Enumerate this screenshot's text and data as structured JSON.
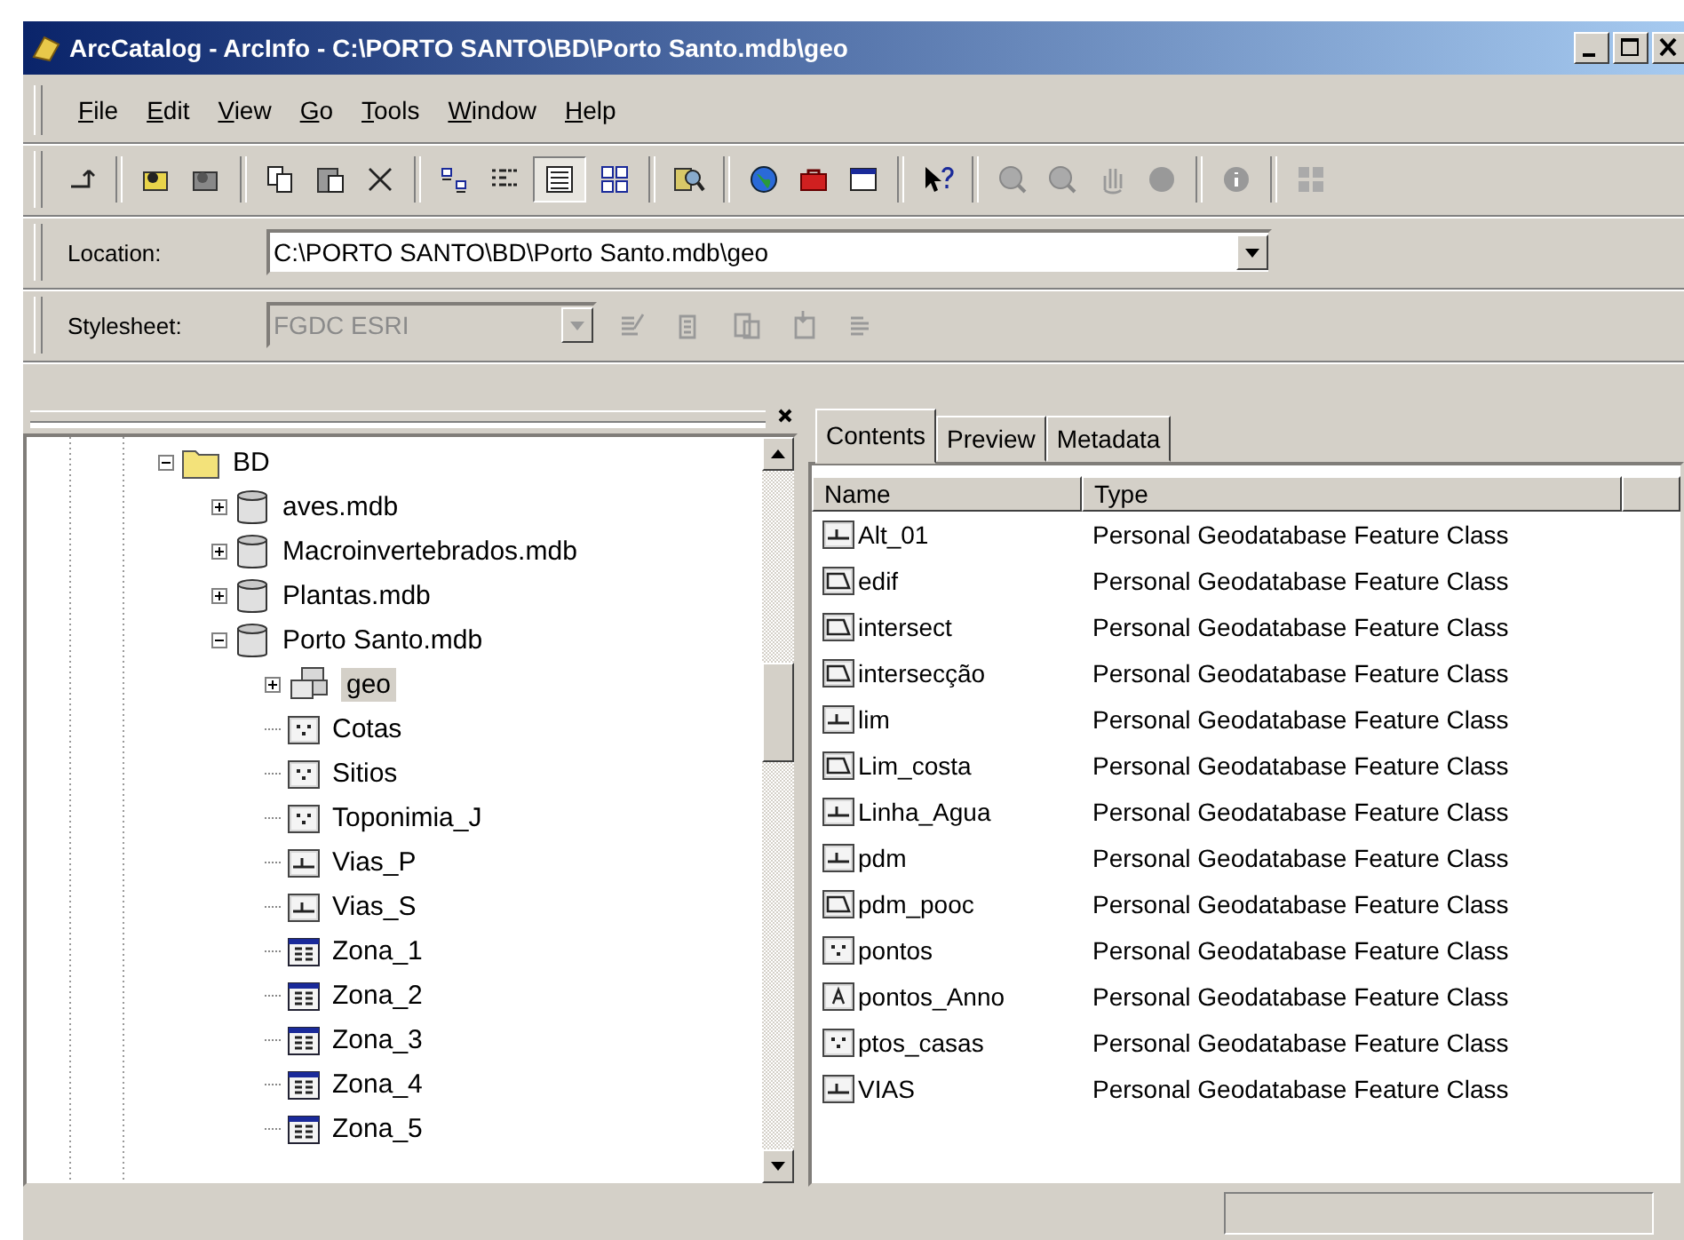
{
  "window": {
    "title": "ArcCatalog - ArcInfo - C:\\PORTO SANTO\\BD\\Porto Santo.mdb\\geo"
  },
  "menu": [
    "File",
    "Edit",
    "View",
    "Go",
    "Tools",
    "Window",
    "Help"
  ],
  "location": {
    "label": "Location:",
    "value": "C:\\PORTO SANTO\\BD\\Porto Santo.mdb\\geo"
  },
  "stylesheet": {
    "label": "Stylesheet:",
    "value": "FGDC ESRI",
    "disabled": true
  },
  "tree": [
    {
      "label": "BD",
      "kind": "folder",
      "expanded": true,
      "selected": false,
      "children": [
        {
          "label": "aves.mdb",
          "kind": "database",
          "expanded": false,
          "selected": false
        },
        {
          "label": "Macroinvertebrados.mdb",
          "kind": "database",
          "expanded": false,
          "selected": false
        },
        {
          "label": "Plantas.mdb",
          "kind": "database",
          "expanded": false,
          "selected": false
        },
        {
          "label": "Porto Santo.mdb",
          "kind": "database",
          "expanded": true,
          "selected": false,
          "children": [
            {
              "label": "geo",
              "kind": "dataset",
              "expanded": false,
              "selected": true
            },
            {
              "label": "Cotas",
              "kind": "point",
              "selected": false
            },
            {
              "label": "Sitios",
              "kind": "point",
              "selected": false
            },
            {
              "label": "Toponimia_J",
              "kind": "point",
              "selected": false
            },
            {
              "label": "Vias_P",
              "kind": "line",
              "selected": false
            },
            {
              "label": "Vias_S",
              "kind": "line",
              "selected": false
            },
            {
              "label": "Zona_1",
              "kind": "table",
              "selected": false
            },
            {
              "label": "Zona_2",
              "kind": "table",
              "selected": false
            },
            {
              "label": "Zona_3",
              "kind": "table",
              "selected": false
            },
            {
              "label": "Zona_4",
              "kind": "table",
              "selected": false
            },
            {
              "label": "Zona_5",
              "kind": "table",
              "selected": false
            }
          ]
        }
      ]
    }
  ],
  "tabs": [
    {
      "label": "Contents",
      "selected": true
    },
    {
      "label": "Preview",
      "selected": false
    },
    {
      "label": "Metadata",
      "selected": false
    }
  ],
  "contents": {
    "columns": [
      "Name",
      "Type"
    ],
    "rows": [
      {
        "name": "Alt_01",
        "kind": "line",
        "type": "Personal Geodatabase Feature Class"
      },
      {
        "name": "edif",
        "kind": "polygon",
        "type": "Personal Geodatabase Feature Class"
      },
      {
        "name": "intersect",
        "kind": "polygon",
        "type": "Personal Geodatabase Feature Class"
      },
      {
        "name": "intersecção",
        "kind": "polygon",
        "type": "Personal Geodatabase Feature Class"
      },
      {
        "name": "lim",
        "kind": "line",
        "type": "Personal Geodatabase Feature Class"
      },
      {
        "name": "Lim_costa",
        "kind": "polygon",
        "type": "Personal Geodatabase Feature Class"
      },
      {
        "name": "Linha_Agua",
        "kind": "line",
        "type": "Personal Geodatabase Feature Class"
      },
      {
        "name": "pdm",
        "kind": "line",
        "type": "Personal Geodatabase Feature Class"
      },
      {
        "name": "pdm_pooc",
        "kind": "polygon",
        "type": "Personal Geodatabase Feature Class"
      },
      {
        "name": "pontos",
        "kind": "point",
        "type": "Personal Geodatabase Feature Class"
      },
      {
        "name": "pontos_Anno",
        "kind": "annotation",
        "type": "Personal Geodatabase Feature Class"
      },
      {
        "name": "ptos_casas",
        "kind": "point",
        "type": "Personal Geodatabase Feature Class"
      },
      {
        "name": "VIAS",
        "kind": "line",
        "type": "Personal Geodatabase Feature Class"
      }
    ]
  }
}
